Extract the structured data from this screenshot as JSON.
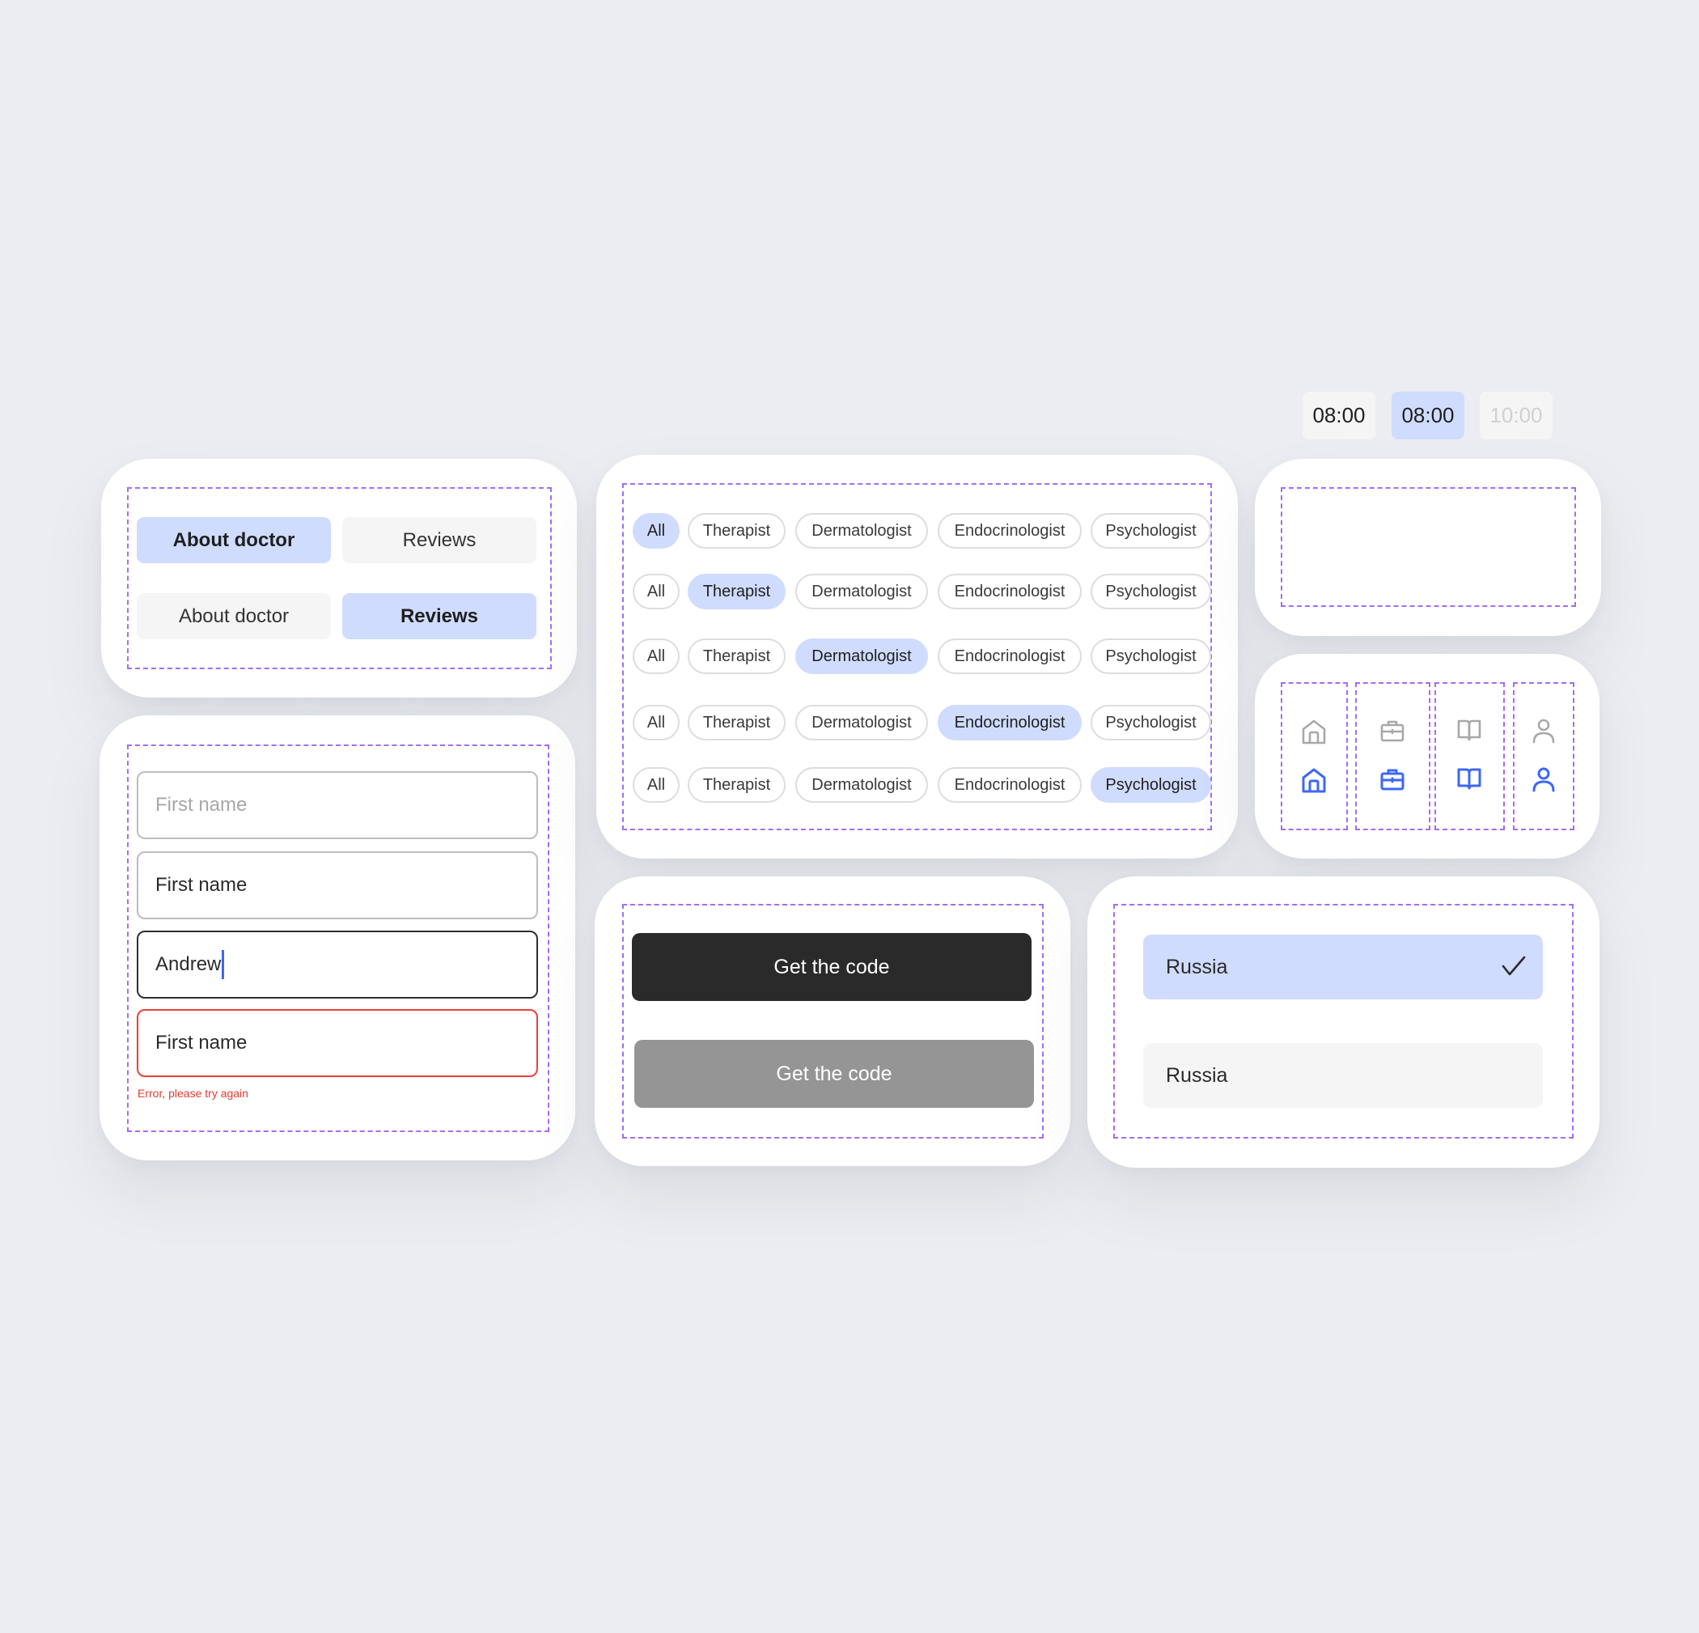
{
  "colors": {
    "background": "#ECEDF2",
    "card": "#FFFFFF",
    "dashed_frame": "#A66CF0",
    "selected": "#D0DCFE",
    "unselected": "#F5F5F5",
    "primary_button": "#2A2A2A",
    "disabled_button": "#959595",
    "active_icon": "#3E67F2",
    "inactive_icon": "#A8A8A8",
    "error": "#E23A31"
  },
  "tabs": {
    "rows": [
      {
        "about": "About doctor",
        "reviews": "Reviews",
        "selected": "about"
      },
      {
        "about": "About doctor",
        "reviews": "Reviews",
        "selected": "reviews"
      }
    ]
  },
  "inputs": {
    "placeholder": "First name",
    "filled_value": "First name",
    "typed_value": "Andrew",
    "error_value": "First name",
    "error_message": "Error, please try again"
  },
  "filters": {
    "chips": [
      "All",
      "Therapist",
      "Dermatologist",
      "Endocrinologist",
      "Psychologist"
    ],
    "rows_selected": [
      "All",
      "Therapist",
      "Dermatologist",
      "Endocrinologist",
      "Psychologist"
    ]
  },
  "time_slots": [
    {
      "label": "08:00",
      "state": "default"
    },
    {
      "label": "08:00",
      "state": "selected"
    },
    {
      "label": "10:00",
      "state": "disabled"
    }
  ],
  "nav_icons": [
    {
      "name": "home-icon",
      "states": [
        "inactive",
        "active"
      ]
    },
    {
      "name": "briefcase-icon",
      "states": [
        "inactive",
        "active"
      ]
    },
    {
      "name": "book-icon",
      "states": [
        "inactive",
        "active"
      ]
    },
    {
      "name": "user-icon",
      "states": [
        "inactive",
        "active"
      ]
    }
  ],
  "buttons": {
    "primary_label": "Get the code",
    "disabled_label": "Get the code"
  },
  "country_select": {
    "selected": "Russia",
    "option": "Russia"
  }
}
